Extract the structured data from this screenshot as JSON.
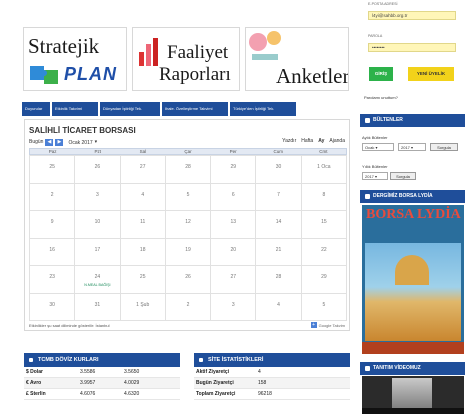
{
  "login": {
    "email_label": "E-POSTA ADRESİ",
    "email_value": "l4yi@sahbb.org.tr",
    "password_label": "PAROLA",
    "password_value": "••••••••",
    "login_button": "GİRİŞ",
    "new_user_button": "YENİ ÜYELİK",
    "forgot_link": "Parolamı unuttum?"
  },
  "banners": {
    "strategic_line1": "Stratejik",
    "strategic_line2": "PLAN",
    "activity_line1": "Faaliyet",
    "activity_line2": "Raporları",
    "surveys": "Anketler"
  },
  "tabs": [
    "Duyurular",
    "Etkinlik Takvimi",
    "Dünyadan İştirliği Tek.",
    "Ihale. Özelleştirme Takvimi",
    "Türkiye'den İştirliği Tek."
  ],
  "calendar": {
    "title": "SALİHLİ TİCARET BORSASI",
    "today": "Bugün",
    "month": "Ocak 2017",
    "views": {
      "print": "Yazdır",
      "week": "Hafta",
      "month": "Ay",
      "agenda": "Ajanda"
    },
    "weekdays": [
      "Paz",
      "Pzt",
      "Sal",
      "Çar",
      "Per",
      "Cum",
      "Cmt"
    ],
    "days": [
      {
        "n": "25",
        "ev": ""
      },
      {
        "n": "26",
        "ev": ""
      },
      {
        "n": "27",
        "ev": ""
      },
      {
        "n": "28",
        "ev": ""
      },
      {
        "n": "29",
        "ev": ""
      },
      {
        "n": "30",
        "ev": ""
      },
      {
        "n": "1 Oca",
        "ev": ""
      },
      {
        "n": "2",
        "ev": ""
      },
      {
        "n": "3",
        "ev": ""
      },
      {
        "n": "4",
        "ev": ""
      },
      {
        "n": "5",
        "ev": ""
      },
      {
        "n": "6",
        "ev": ""
      },
      {
        "n": "7",
        "ev": ""
      },
      {
        "n": "8",
        "ev": ""
      },
      {
        "n": "9",
        "ev": ""
      },
      {
        "n": "10",
        "ev": ""
      },
      {
        "n": "11",
        "ev": ""
      },
      {
        "n": "12",
        "ev": ""
      },
      {
        "n": "13",
        "ev": ""
      },
      {
        "n": "14",
        "ev": ""
      },
      {
        "n": "15",
        "ev": ""
      },
      {
        "n": "16",
        "ev": ""
      },
      {
        "n": "17",
        "ev": ""
      },
      {
        "n": "18",
        "ev": ""
      },
      {
        "n": "19",
        "ev": ""
      },
      {
        "n": "20",
        "ev": ""
      },
      {
        "n": "21",
        "ev": ""
      },
      {
        "n": "22",
        "ev": ""
      },
      {
        "n": "23",
        "ev": ""
      },
      {
        "n": "24",
        "ev": "N.MEAL BAĞIŞI"
      },
      {
        "n": "25",
        "ev": ""
      },
      {
        "n": "26",
        "ev": ""
      },
      {
        "n": "27",
        "ev": ""
      },
      {
        "n": "28",
        "ev": ""
      },
      {
        "n": "29",
        "ev": ""
      },
      {
        "n": "30",
        "ev": ""
      },
      {
        "n": "31",
        "ev": ""
      },
      {
        "n": "1 Şub",
        "ev": ""
      },
      {
        "n": "2",
        "ev": ""
      },
      {
        "n": "3",
        "ev": ""
      },
      {
        "n": "4",
        "ev": ""
      },
      {
        "n": "5",
        "ev": ""
      }
    ],
    "footer": "Etkinlikler şu saat diliminde gösterilir: İstanbul",
    "google": "Google Takvim"
  },
  "currency": {
    "title": "TCMB DÖVİZ KURLARI",
    "rows": [
      {
        "name": "$ Dolar",
        "buy": "3.5586",
        "sell": "3.5650"
      },
      {
        "name": "€ Avro",
        "buy": "3.9957",
        "sell": "4.0029"
      },
      {
        "name": "£ Sterlin",
        "buy": "4.6076",
        "sell": "4.6320"
      }
    ]
  },
  "stats": {
    "title": "SİTE İSTATİSTİKLERİ",
    "rows": [
      {
        "name": "Aktif Ziyaretçi",
        "value": "4"
      },
      {
        "name": "Bugün Ziyaretçi",
        "value": "158"
      },
      {
        "name": "Toplam Ziyaretçi",
        "value": "96218"
      }
    ]
  },
  "right": {
    "bulletins_title": "BÜLTENLER",
    "monthly_label": "Aylık Bültenler",
    "monthly_month": "Ocak",
    "monthly_year": "2017",
    "query": "Sorgula",
    "yearly_label": "Yıllık Bültenler",
    "yearly_year": "2017",
    "magazine_title": "DERGİMİZ BORSA LYDİA",
    "magazine_name": "BORSA LYDİA",
    "video_title": "TANITIM VİDEOMUZ"
  }
}
